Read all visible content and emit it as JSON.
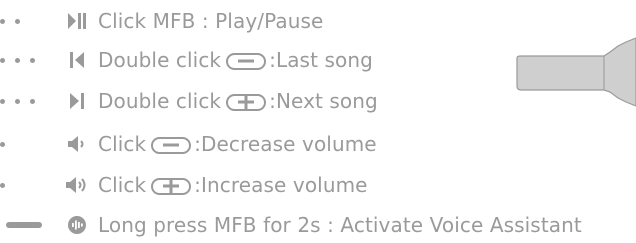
{
  "rows": [
    {
      "before": "Click MFB : Play/Pause",
      "after": ""
    },
    {
      "before": "Double click",
      "after": ":Last song"
    },
    {
      "before": "Double click",
      "after": ":Next song"
    },
    {
      "before": "Click",
      "after": ":Decrease volume"
    },
    {
      "before": "Click",
      "after": ":Increase volume"
    },
    {
      "before": "Long press MFB for 2s : Activate Voice Assistant",
      "after": ""
    }
  ],
  "colors": {
    "ink": "#9a9a9a",
    "device": "#cfcfcf"
  },
  "icons": [
    "play-pause-icon",
    "previous-track-icon",
    "next-track-icon",
    "volume-down-icon",
    "volume-up-icon",
    "voice-assistant-icon"
  ]
}
